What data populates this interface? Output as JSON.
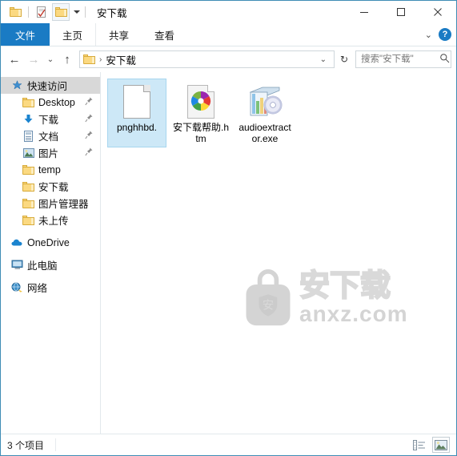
{
  "window": {
    "title": "安下载",
    "quick_access": [
      {
        "name": "folder-icon",
        "label": "新建文件夹"
      },
      {
        "name": "properties-icon",
        "label": "属性"
      },
      {
        "name": "folder-customize-icon",
        "label": "自定义快速访问工具栏"
      }
    ],
    "controls": {
      "minimize": "最小化",
      "maximize": "最大化",
      "close": "关闭"
    }
  },
  "ribbon": {
    "tabs": [
      {
        "label": "文件",
        "selected": true
      },
      {
        "label": "主页",
        "selected": false
      },
      {
        "label": "共享",
        "selected": false
      },
      {
        "label": "查看",
        "selected": false
      }
    ],
    "expand_label": "展开功能区",
    "help_label": "?"
  },
  "navbar": {
    "back": "←",
    "forward": "→",
    "recent": "⌄",
    "up": "↑",
    "breadcrumb": {
      "icon": "folder-icon",
      "path": "安下载",
      "separator": "›",
      "dropdown": "⌄"
    },
    "refresh": "↻",
    "search": {
      "placeholder": "搜索\"安下载\"",
      "icon": "search-icon"
    }
  },
  "sidebar": {
    "items": [
      {
        "label": "快速访问",
        "icon": "star-icon",
        "level": 0,
        "selected": true,
        "pinned": false
      },
      {
        "label": "Desktop",
        "icon": "folder-icon",
        "level": 1,
        "selected": false,
        "pinned": true
      },
      {
        "label": "下载",
        "icon": "download-icon",
        "level": 1,
        "selected": false,
        "pinned": true
      },
      {
        "label": "文档",
        "icon": "document-icon",
        "level": 1,
        "selected": false,
        "pinned": true
      },
      {
        "label": "图片",
        "icon": "pictures-icon",
        "level": 1,
        "selected": false,
        "pinned": true
      },
      {
        "label": "temp",
        "icon": "folder-icon",
        "level": 1,
        "selected": false,
        "pinned": false
      },
      {
        "label": "安下载",
        "icon": "folder-icon",
        "level": 1,
        "selected": false,
        "pinned": false
      },
      {
        "label": "图片管理器",
        "icon": "folder-icon",
        "level": 1,
        "selected": false,
        "pinned": false
      },
      {
        "label": "未上传",
        "icon": "folder-icon",
        "level": 1,
        "selected": false,
        "pinned": false
      },
      {
        "label": "OneDrive",
        "icon": "cloud-icon",
        "level": 0,
        "selected": false,
        "pinned": false
      },
      {
        "label": "此电脑",
        "icon": "computer-icon",
        "level": 0,
        "selected": false,
        "pinned": false
      },
      {
        "label": "网络",
        "icon": "network-icon",
        "level": 0,
        "selected": false,
        "pinned": false
      }
    ]
  },
  "files": [
    {
      "name": "pnghhbd.",
      "icon": "blank-document-icon",
      "selected": true
    },
    {
      "name": "安下载帮助.htm",
      "icon": "html-document-icon",
      "selected": false
    },
    {
      "name": "audioextractor.exe",
      "icon": "application-disc-icon",
      "selected": false
    }
  ],
  "watermark": {
    "brand": "安下载",
    "domain": "anxz.com",
    "shield_char": "安"
  },
  "statusbar": {
    "item_count": "3 个项目",
    "views": [
      {
        "name": "details-view-button",
        "active": false
      },
      {
        "name": "large-icons-view-button",
        "active": true
      }
    ]
  },
  "colors": {
    "accent": "#1a7bc4",
    "window_border": "#3f8cb5",
    "selection": "#cde8f7",
    "nav_selected": "#d8d8d8"
  }
}
